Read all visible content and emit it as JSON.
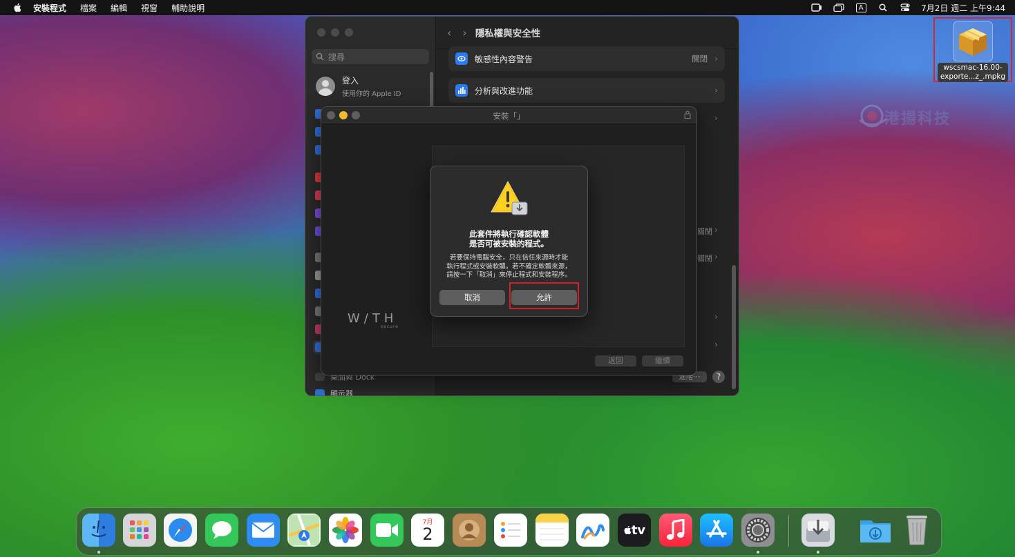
{
  "menubar": {
    "app_name": "安裝程式",
    "items": [
      "檔案",
      "編輯",
      "視窗",
      "輔助說明"
    ],
    "input_indicator": "A",
    "clock": "7月2日 週二 上午9:44"
  },
  "desktop_icon": {
    "label_line1": "wscsmac-16.00-",
    "label_line2": "exporte...z_.mpkg"
  },
  "watermark": {
    "text": "港揚科技"
  },
  "settings_window": {
    "title": "隱私權與安全性",
    "search_placeholder": "搜尋",
    "account": {
      "name": "登入",
      "subtitle": "使用你的 Apple ID"
    },
    "rows": [
      {
        "label": "敏感性內容警告",
        "value": "關閉"
      },
      {
        "label": "分析與改進功能",
        "value": ""
      }
    ],
    "obscured_values": [
      "關閉",
      "關閉"
    ],
    "sidebar_bottom": [
      "桌面與 Dock",
      "顯示器"
    ],
    "advanced_label": "進階⋯",
    "help_label": "?"
  },
  "installer_window": {
    "title": "安裝「」",
    "logo": "W/TH",
    "logo_sub": "secure",
    "back_label": "返回",
    "continue_label": "繼續"
  },
  "alert": {
    "title_line1": "此套件將執行確認軟體",
    "title_line2": "是否可被安裝的程式。",
    "message_line1": "若要保持電腦安全，只在信任來源時才能",
    "message_line2": "執行程式或安裝軟體。若不確定軟體來源，",
    "message_line3": "請按一下「取消」來停止程式和安裝程序。",
    "cancel_label": "取消",
    "allow_label": "允許"
  },
  "dock": {
    "calendar_month": "7月",
    "calendar_day": "2",
    "tv_label": "tv",
    "apps": [
      "Finder",
      "Launchpad",
      "Safari",
      "訊息",
      "郵件",
      "地圖",
      "照片",
      "FaceTime",
      "行事曆",
      "聯絡人",
      "提醒事項",
      "備忘錄",
      "無邊記",
      "Apple TV",
      "音樂",
      "App Store",
      "系統設定",
      "安裝程式",
      "下載項目",
      "垃圾桶"
    ]
  },
  "colors": {
    "alert_highlight": "#d0202a",
    "accent_blue": "#2c7bf0",
    "warning_yellow": "#f6c21b"
  }
}
